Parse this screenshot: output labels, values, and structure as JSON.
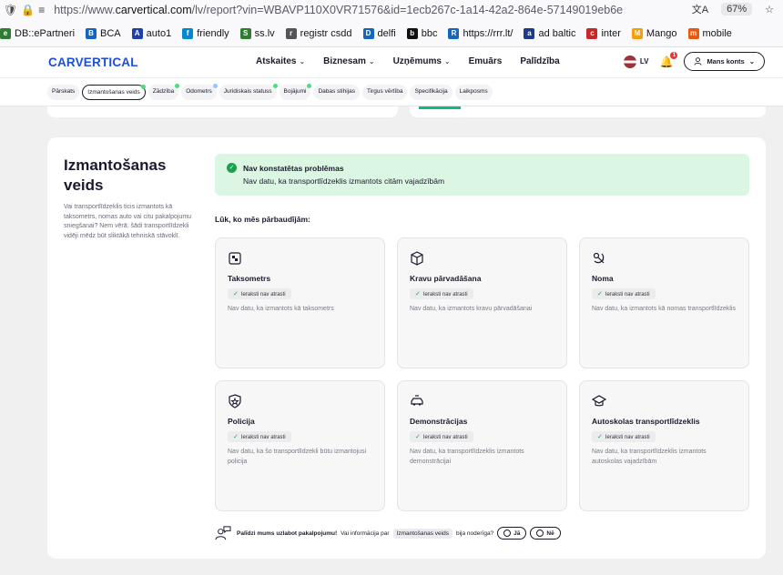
{
  "browser": {
    "url_prefix": "https://www.",
    "url_domain": "carvertical.com",
    "url_rest": "/lv/report?vin=WBAVP110X0VR71576&id=1ecb267c-1a14-42a2-864e-57149019eb6e",
    "zoom": "67%",
    "bookmarks": [
      {
        "label": "DB::ePartneri",
        "color": "#2e7d32",
        "glyph": "e"
      },
      {
        "label": "BCA",
        "color": "#1565c0",
        "glyph": "B"
      },
      {
        "label": "auto1",
        "color": "#1e40af",
        "glyph": "A"
      },
      {
        "label": "friendly",
        "color": "#0288d1",
        "glyph": "f"
      },
      {
        "label": "ss.lv",
        "color": "#2e7d32",
        "glyph": "SS"
      },
      {
        "label": "registr csdd",
        "color": "#555555",
        "glyph": "r"
      },
      {
        "label": "delfi",
        "color": "#1565c0",
        "glyph": "D"
      },
      {
        "label": "bbc",
        "color": "#111111",
        "glyph": "bbc"
      },
      {
        "label": "https://rrr.lt/",
        "color": "#1565c0",
        "glyph": "R"
      },
      {
        "label": "ad baltic",
        "color": "#1e3a8a",
        "glyph": "ad"
      },
      {
        "label": "inter",
        "color": "#c62828",
        "glyph": "c"
      },
      {
        "label": "Mango",
        "color": "#f59e0b",
        "glyph": "M"
      },
      {
        "label": "mobile",
        "color": "#ea580c",
        "glyph": "m"
      }
    ]
  },
  "header": {
    "logo": "CARVERTICAL",
    "nav": [
      "Atskaites",
      "Biznesam",
      "Uzņēmums",
      "Emuārs",
      "Palīdzība"
    ],
    "nav_has_dropdown": [
      true,
      true,
      true,
      false,
      false
    ],
    "lang": "LV",
    "notification_count": "1",
    "account_label": "Mans konts"
  },
  "tabs": [
    {
      "label": "Pārskats",
      "dot": ""
    },
    {
      "label": "Izmantošanas veids",
      "dot": "green",
      "active": true
    },
    {
      "label": "Zādzība",
      "dot": "green"
    },
    {
      "label": "Odometrs",
      "dot": "blue"
    },
    {
      "label": "Juridiskais statuss",
      "dot": "green"
    },
    {
      "label": "Bojājumi",
      "dot": "green"
    },
    {
      "label": "Dabas stihijas",
      "dot": ""
    },
    {
      "label": "Tirgus vērtība",
      "dot": ""
    },
    {
      "label": "Specifikācija",
      "dot": ""
    },
    {
      "label": "Laikposms",
      "dot": ""
    }
  ],
  "section": {
    "title": "Izmantošanas veids",
    "description": "Vai transportlīdzeklis ticis izmantots kā taksometrs, nomas auto vai citu pakalpojumu sniegšanai? Nem vērā: šādi transportlīdzekļi vidēji mēdz būt sliktākā tehniskā stāvoklī.",
    "alert_title": "Nav konstatētas problēmas",
    "alert_text": "Nav datu, ka transportlīdzeklis izmantots citām vajadzībām",
    "checked_title": "Lūk, ko mēs pārbaudījām:",
    "cards": [
      {
        "icon": "taxi-meter-icon",
        "title": "Taksometrs",
        "badge": "Ieraksti nav atrasti",
        "desc": "Nav datu, ka izmantots kā taksometrs"
      },
      {
        "icon": "box-icon",
        "title": "Kravu pārvadāšana",
        "badge": "Ieraksti nav atrasti",
        "desc": "Nav datu, ka izmantots kravu pārvadāšanai"
      },
      {
        "icon": "rental-key-icon",
        "title": "Noma",
        "badge": "Ieraksti nav atrasti",
        "desc": "Nav datu, ka izmantots kā nomas transportlīdzeklis"
      },
      {
        "icon": "police-badge-icon",
        "title": "Policija",
        "badge": "Ieraksti nav atrasti",
        "desc": "Nav datu, ka šo transportlīdzekli būtu izmantojusi policija"
      },
      {
        "icon": "demo-car-icon",
        "title": "Demonstrācijas",
        "badge": "Ieraksti nav atrasti",
        "desc": "Nav datu, ka transportlīdzeklis izmantots demonstrācijai"
      },
      {
        "icon": "graduation-cap-icon",
        "title": "Autoskolas transportlīdzeklis",
        "badge": "Ieraksti nav atrasti",
        "desc": "Nav datu, ka transportlīdzeklis izmantots autoskolas vajadzībām"
      }
    ],
    "feedback": {
      "lead": "Palīdzi mums uzlabot pakalpojumu!",
      "question_a": "Vai informācija par",
      "chip": "Izmantošanas veids",
      "question_b": "bija noderīga?",
      "yes": "Jā",
      "no": "Nē"
    }
  }
}
